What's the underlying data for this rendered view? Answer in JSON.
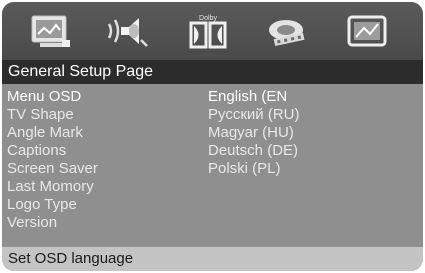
{
  "icon_bar": {
    "icons": [
      {
        "name": "general-setup-icon"
      },
      {
        "name": "audio-setup-icon"
      },
      {
        "name": "dolby-setup-icon",
        "label": "Dolby"
      },
      {
        "name": "video-setup-icon"
      },
      {
        "name": "preference-setup-icon"
      }
    ]
  },
  "page": {
    "title": "General Setup Page"
  },
  "menu": {
    "items": [
      {
        "label": "Menu OSD"
      },
      {
        "label": "TV Shape"
      },
      {
        "label": "Angle Mark"
      },
      {
        "label": "Captions"
      },
      {
        "label": "Screen Saver"
      },
      {
        "label": "Last Momory"
      },
      {
        "label": "Logo Type"
      },
      {
        "label": "Version"
      }
    ],
    "selected": "Menu OSD"
  },
  "options": {
    "items": [
      {
        "label": "English (EN"
      },
      {
        "label": "Русский (RU)"
      },
      {
        "label": "Magyar (HU)"
      },
      {
        "label": "Deutsch (DE)"
      },
      {
        "label": "Polski (PL)"
      }
    ],
    "selected": "English (EN"
  },
  "status": {
    "text": "Set OSD language"
  },
  "colors": {
    "icon_bar_bg": "#505050",
    "title_bar_bg": "#2c2c2c",
    "body_bg": "#8f8f8f",
    "status_bar_bg": "#c4c4c4",
    "text": "#ffffff"
  }
}
